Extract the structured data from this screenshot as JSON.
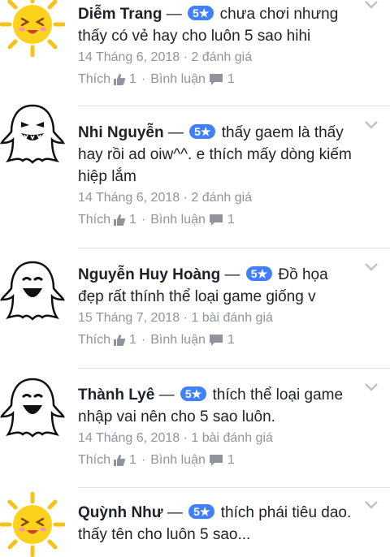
{
  "reviews": [
    {
      "name": "Diễm Trang",
      "rating": "5★",
      "text": "chưa chơi nhưng thấy có vẻ hay cho luôn 5 sao hihi",
      "meta": "14 Tháng 6, 2018 · 2 đánh giá",
      "like_label": "Thích",
      "like_count": "1",
      "comment_label": "Bình luận",
      "comment_count": "1",
      "avatar": "sun-emoji"
    },
    {
      "name": "Nhi Nguyễn",
      "rating": "5★",
      "text": "thấy gaem là thấy hay rồi ad oiw^^. e thích mấy dòng kiếm hiệp lắm",
      "meta": "14 Tháng 6, 2018 · 2 đánh giá",
      "like_label": "Thích",
      "like_count": "1",
      "comment_label": "Bình luận",
      "comment_count": "1",
      "avatar": "ghost"
    },
    {
      "name": "Nguyễn Huy Hoàng",
      "rating": "5★",
      "text": "Đồ họa đẹp rất thính thể loại game giống v",
      "meta": "15 Tháng 7, 2018 · 1 bài đánh giá",
      "like_label": "Thích",
      "like_count": "1",
      "comment_label": "Bình luận",
      "comment_count": "1",
      "avatar": "ghost"
    },
    {
      "name": "Thành Lyê",
      "rating": "5★",
      "text": "thích thể loại game nhập vai nên cho 5 sao luôn.",
      "meta": "14 Tháng 6, 2018 · 1 bài đánh giá",
      "like_label": "Thích",
      "like_count": "1",
      "comment_label": "Bình luận",
      "comment_count": "1",
      "avatar": "ghost"
    },
    {
      "name": "Quỳnh Như",
      "rating": "5★",
      "text": "thích phái tiêu dao. thấy tên cho luôn 5 sao...",
      "avatar": "sun-emoji"
    }
  ],
  "dash": "—",
  "colors": {
    "badge": "#4080ff",
    "meta": "#90949c",
    "divider": "#dddfe2"
  }
}
